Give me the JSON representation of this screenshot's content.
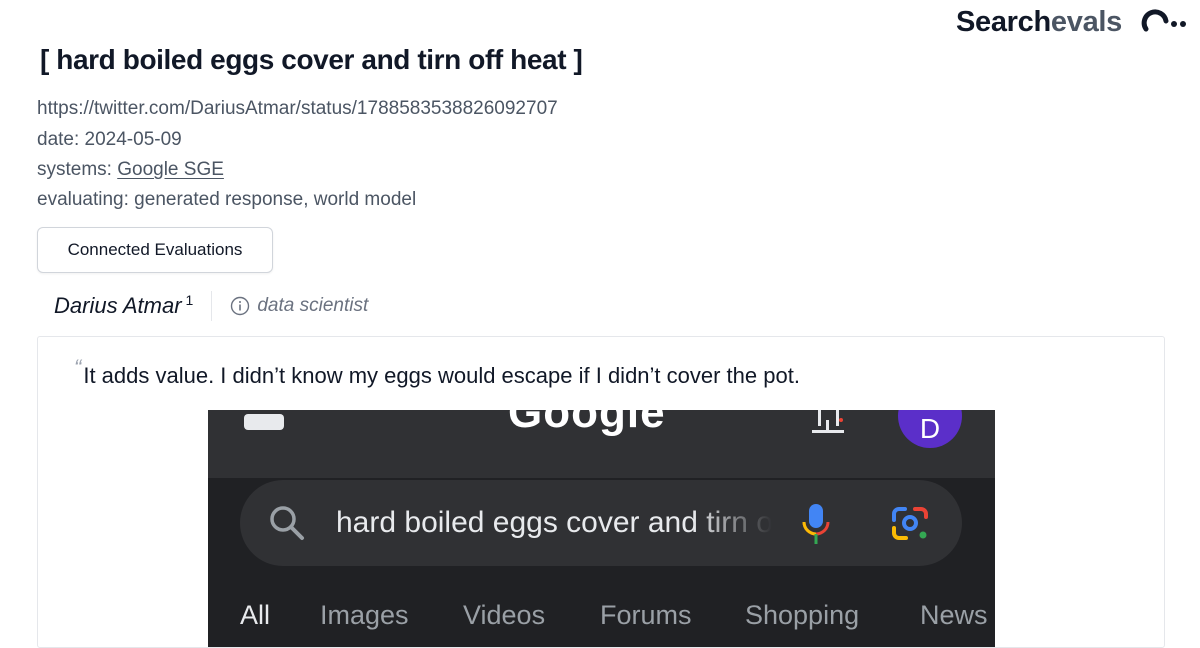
{
  "brand": {
    "part1": "Search",
    "part2": "evals",
    "icon": "searchevals-logo-icon"
  },
  "page": {
    "title": "[ hard boiled eggs cover and tirn off heat ]",
    "url": "https://twitter.com/DariusAtmar/status/1788583538826092707",
    "date_label": "date: 2024-05-09",
    "systems_prefix": "systems: ",
    "systems_link": "Google SGE",
    "evaluating": "evaluating: generated response, world model",
    "connected_button": "Connected Evaluations"
  },
  "author": {
    "name": "Darius Atmar",
    "count": "1",
    "info_icon": "info-icon",
    "role": "data scientist"
  },
  "quote": {
    "mark": "“",
    "text": "It adds value. I didn’t know my eggs would escape if I didn’t cover the pot."
  },
  "screenshot": {
    "logo": "Google",
    "avatar_letter": "D",
    "query": "hard boiled eggs cover and tirn off heat",
    "tabs": [
      "All",
      "Images",
      "Videos",
      "Forums",
      "Shopping",
      "News"
    ],
    "colors": {
      "background": "#202124",
      "surface": "#303134",
      "avatar": "#5b2fc9"
    }
  }
}
